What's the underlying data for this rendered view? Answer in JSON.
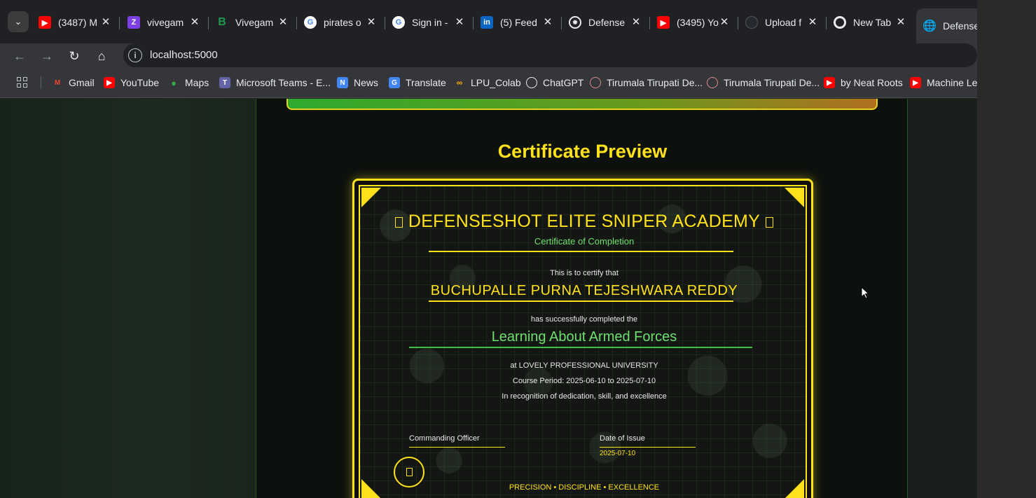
{
  "browser": {
    "tabs": [
      {
        "title": "(3487) M",
        "favicon": "youtube-icon",
        "color": "#ff0000"
      },
      {
        "title": "vivegam",
        "favicon": "zee-icon",
        "color": "#7b3fe4"
      },
      {
        "title": "Vivegam",
        "favicon": "bing-icon",
        "color": "#1f7a3f"
      },
      {
        "title": "pirates o",
        "favicon": "google-icon",
        "color": "#4285f4"
      },
      {
        "title": "Sign in -",
        "favicon": "google-icon",
        "color": "#4285f4"
      },
      {
        "title": "(5) Feed",
        "favicon": "linkedin-icon",
        "color": "#0a66c2"
      },
      {
        "title": "Defense",
        "favicon": "openai-icon",
        "color": "#e8eaed"
      },
      {
        "title": "(3495) Yo",
        "favicon": "youtube-icon",
        "color": "#ff0000"
      },
      {
        "title": "Upload f",
        "favicon": "github-icon",
        "color": "#24292f"
      },
      {
        "title": "New Tab",
        "favicon": "chrome-icon",
        "color": "#e8eaed"
      },
      {
        "title": "Defense",
        "favicon": "globe-icon",
        "color": "#9aa0a6"
      }
    ],
    "url": "localhost:5000",
    "bookmarks": [
      {
        "label": "Gmail",
        "icon": "gmail-icon",
        "color": "#ea4335"
      },
      {
        "label": "YouTube",
        "icon": "youtube-icon",
        "color": "#ff0000"
      },
      {
        "label": "Maps",
        "icon": "maps-pin-icon",
        "color": "#34a853"
      },
      {
        "label": "Microsoft Teams - E...",
        "icon": "teams-icon",
        "color": "#6264a7"
      },
      {
        "label": "News",
        "icon": "news-icon",
        "color": "#4285f4"
      },
      {
        "label": "Translate",
        "icon": "translate-icon",
        "color": "#4285f4"
      },
      {
        "label": "LPU_Colab",
        "icon": "colab-icon",
        "color": "#f9ab00"
      },
      {
        "label": "ChatGPT",
        "icon": "openai-icon",
        "color": "#e8eaed"
      },
      {
        "label": "Tirumala Tirupati De...",
        "icon": "ttd-icon",
        "color": "#d98c8c"
      },
      {
        "label": "Tirumala Tirupati De...",
        "icon": "ttd-icon",
        "color": "#d98c8c"
      },
      {
        "label": "by Neat Roots",
        "icon": "youtube-icon",
        "color": "#ff0000"
      },
      {
        "label": "Machine Lea",
        "icon": "youtube-icon",
        "color": "#ff0000"
      }
    ]
  },
  "page": {
    "preview_title": "Certificate Preview",
    "certificate": {
      "academy": "DEFENSESHOT ELITE SNIPER ACADEMY",
      "type": "Certificate of Completion",
      "certify_text": "This is to certify that",
      "recipient": "BUCHUPALLE PURNA TEJESHWARA REDDY",
      "completed_text": "has successfully completed the",
      "course": "Learning About Armed Forces",
      "institution": "at LOVELY PROFESSIONAL UNIVERSITY",
      "period": "Course Period: 2025-06-10 to 2025-07-10",
      "recognition": "In recognition of dedication, skill, and excellence",
      "officer_label": "Commanding Officer",
      "date_label": "Date of Issue",
      "date_value": "2025-07-10",
      "motto": "PRECISION • DISCIPLINE • EXCELLENCE"
    }
  },
  "colors": {
    "accent_yellow": "#ffe21a",
    "accent_green": "#6ee06e",
    "panel_bg": "#0d110d"
  }
}
